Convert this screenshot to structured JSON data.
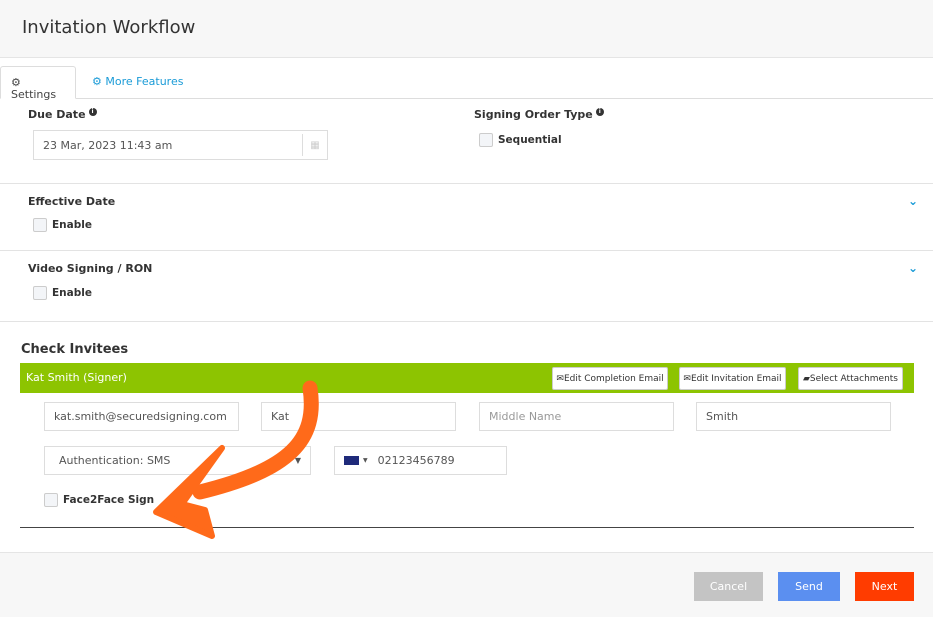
{
  "header": {
    "title": "Invitation Workflow"
  },
  "tabs": [
    {
      "label": "Settings",
      "icon": "gear-icon",
      "active": true
    },
    {
      "label": "More Features",
      "icon": "gears-icon"
    }
  ],
  "due_date": {
    "label": "Due Date",
    "value": "23 Mar, 2023 11:43 am",
    "icon": "calendar-icon"
  },
  "signing_order": {
    "label": "Signing Order Type",
    "option": "Sequential",
    "checked": false
  },
  "effective_date": {
    "label": "Effective Date",
    "option": "Enable",
    "checked": false
  },
  "video_signing": {
    "label": "Video Signing / RON",
    "option": "Enable",
    "checked": false
  },
  "invitees": {
    "heading": "Check Invitees",
    "signer": {
      "title": "Kat Smith (Signer)",
      "buttons": [
        "Edit Completion Email",
        "Edit Invitation Email",
        "Select Attachments"
      ],
      "email": "kat.smith@securedsigning.com",
      "first_name": "Kat",
      "middle_placeholder": "Middle Name",
      "last_name": "Smith",
      "authentication": "Authentication: SMS",
      "phone": "02123456789",
      "face2face_label": "Face2Face Sign",
      "face2face_checked": false
    }
  },
  "footer": {
    "cancel": "Cancel",
    "send": "Send",
    "next": "Next"
  },
  "colors": {
    "accent": "#1a9bd7",
    "signer_bar": "#8dc401",
    "cancel": "#c4c4c4",
    "send": "#5b8ff0",
    "next": "#ff3c00",
    "annotation_arrow": "#ff6a1a"
  }
}
